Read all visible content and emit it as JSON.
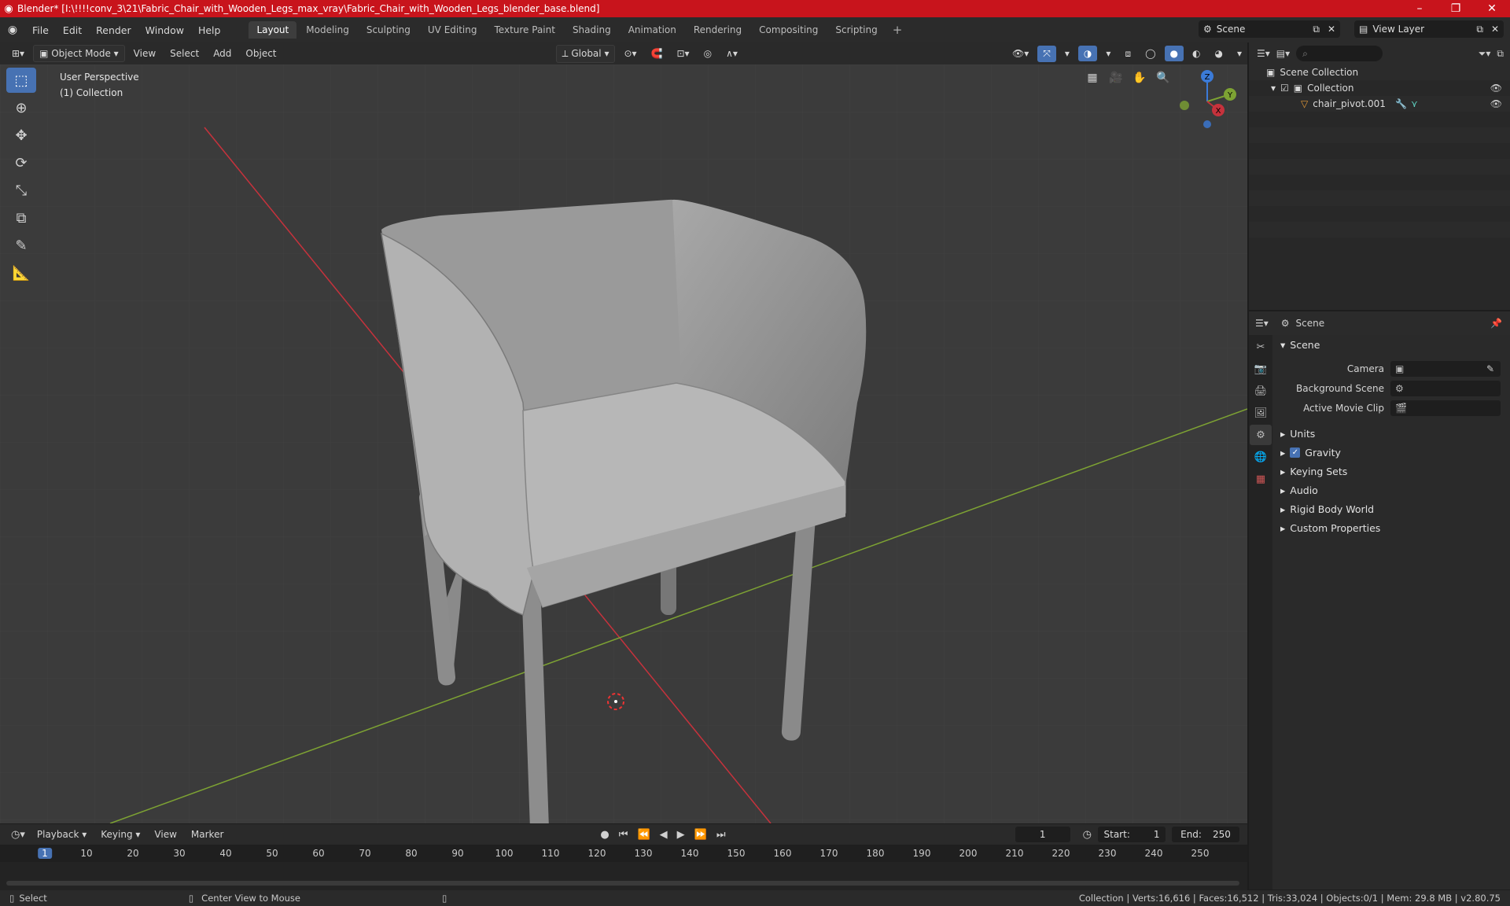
{
  "window": {
    "title": "Blender* [I:\\!!!!conv_3\\21\\Fabric_Chair_with_Wooden_Legs_max_vray\\Fabric_Chair_with_Wooden_Legs_blender_base.blend]",
    "minimize": "–",
    "maximize": "❐",
    "close": "✕"
  },
  "menu": {
    "items": [
      "File",
      "Edit",
      "Render",
      "Window",
      "Help"
    ],
    "workspaces": [
      "Layout",
      "Modeling",
      "Sculpting",
      "UV Editing",
      "Texture Paint",
      "Shading",
      "Animation",
      "Rendering",
      "Compositing",
      "Scripting"
    ],
    "active_workspace": "Layout",
    "add_workspace": "+",
    "scene": "Scene",
    "view_layer": "View Layer"
  },
  "viewport_header": {
    "mode": "Object Mode",
    "menus": [
      "View",
      "Select",
      "Add",
      "Object"
    ],
    "transform_orientation": "Global"
  },
  "viewport": {
    "perspective_label": "User Perspective",
    "collection_label": "(1) Collection",
    "background_color": "#3b3b3b",
    "x_axis_color": "#c6323c",
    "y_axis_color": "#7da233",
    "tools": [
      "select-box-icon",
      "cursor-icon",
      "move-icon",
      "rotate-icon",
      "scale-icon",
      "transform-icon",
      "annotate-icon",
      "measure-icon"
    ],
    "gizmo": {
      "z": "Z",
      "y": "Y",
      "x": "X"
    }
  },
  "outliner": {
    "search_placeholder": "",
    "rows": [
      {
        "label": "Scene Collection"
      },
      {
        "label": "Collection"
      },
      {
        "label": "chair_pivot.001"
      }
    ]
  },
  "properties": {
    "header_title": "Scene",
    "panel_title": "Scene",
    "fields": [
      {
        "label": "Camera",
        "value": ""
      },
      {
        "label": "Background Scene",
        "value": ""
      },
      {
        "label": "Active Movie Clip",
        "value": ""
      }
    ],
    "subpanels": [
      "Units",
      "Gravity",
      "Keying Sets",
      "Audio",
      "Rigid Body World",
      "Custom Properties"
    ],
    "gravity_checked": true
  },
  "timeline": {
    "menus": [
      "Playback",
      "Keying",
      "View",
      "Marker"
    ],
    "current_frame": "1",
    "start_label": "Start:",
    "start": "1",
    "end_label": "End:",
    "end": "250",
    "ruler_ticks": [
      "1",
      "10",
      "20",
      "30",
      "40",
      "50",
      "60",
      "70",
      "80",
      "90",
      "100",
      "110",
      "120",
      "130",
      "140",
      "150",
      "160",
      "170",
      "180",
      "190",
      "200",
      "210",
      "220",
      "230",
      "240",
      "250"
    ]
  },
  "status": {
    "left_action": "Select",
    "middle_action": "Center View to Mouse",
    "stats": "Collection | Verts:16,616 | Faces:16,512 | Tris:33,024 | Objects:0/1 | Mem: 29.8 MB | v2.80.75"
  },
  "accent_color": "#4772b3"
}
